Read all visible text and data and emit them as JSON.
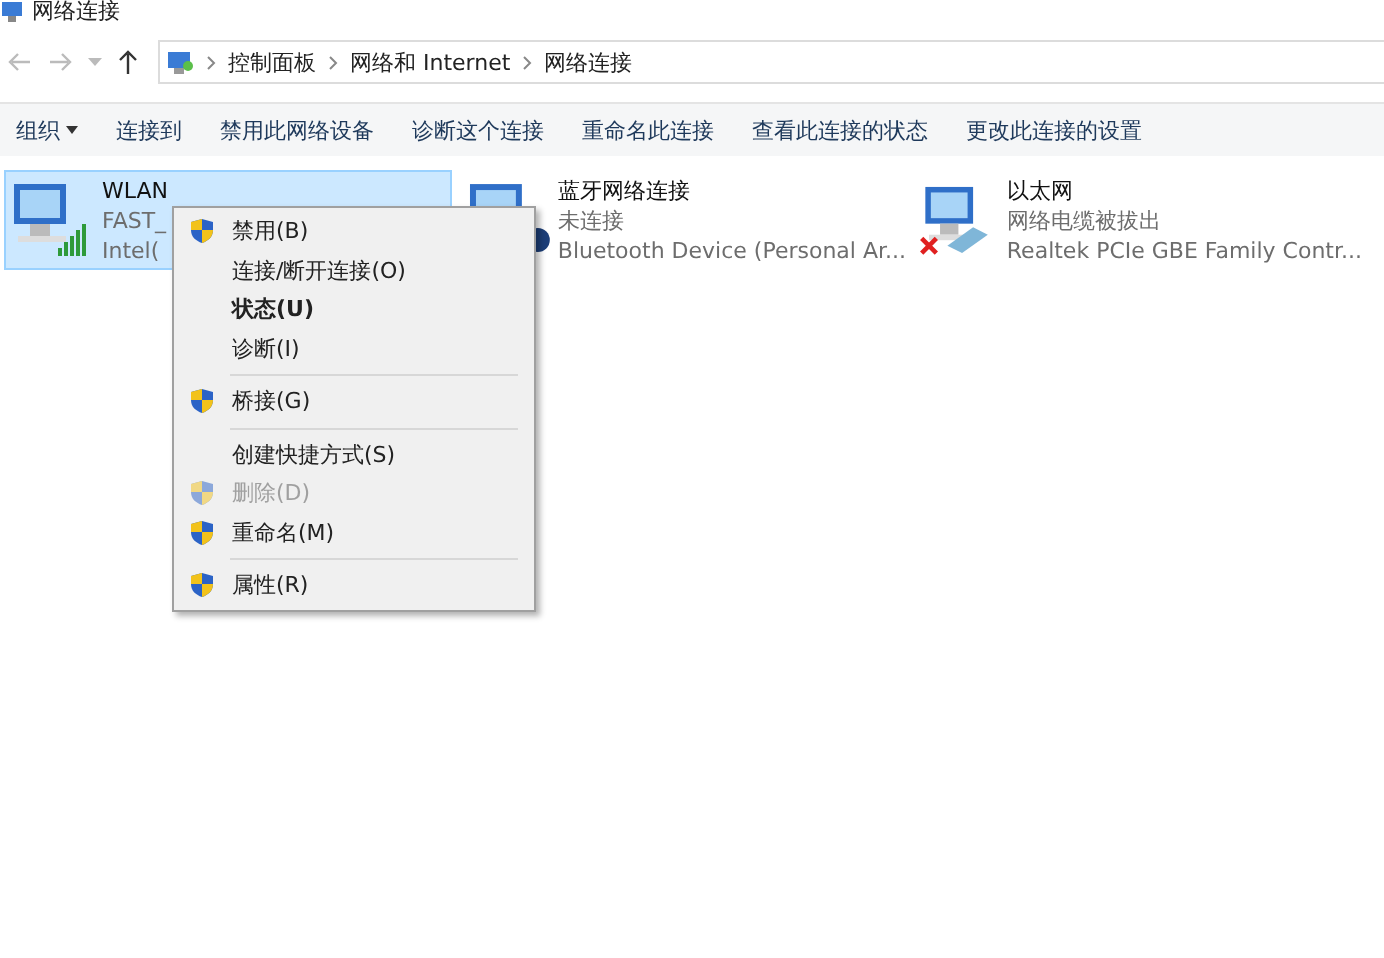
{
  "window": {
    "title": "网络连接"
  },
  "address_bar": {
    "crumbs": [
      "控制面板",
      "网络和 Internet",
      "网络连接"
    ]
  },
  "toolbar": [
    {
      "label": "组织",
      "dropdown": true
    },
    {
      "label": "连接到",
      "dropdown": false
    },
    {
      "label": "禁用此网络设备",
      "dropdown": false
    },
    {
      "label": "诊断这个连接",
      "dropdown": false
    },
    {
      "label": "重命名此连接",
      "dropdown": false
    },
    {
      "label": "查看此连接的状态",
      "dropdown": false
    },
    {
      "label": "更改此连接的设置",
      "dropdown": false
    }
  ],
  "connections": [
    {
      "name": "WLAN",
      "status": "FAST_",
      "device": "Intel(",
      "kind": "wifi",
      "selected": true
    },
    {
      "name": "蓝牙网络连接",
      "status": "未连接",
      "device": "Bluetooth Device (Personal Ar...",
      "kind": "bluetooth",
      "selected": false
    },
    {
      "name": "以太网",
      "status": "网络电缆被拔出",
      "device": "Realtek PCIe GBE Family Contr...",
      "kind": "ethernet",
      "selected": false
    }
  ],
  "context_menu": [
    {
      "kind": "item",
      "label": "禁用(B)",
      "shield": true,
      "disabled": false,
      "default": false
    },
    {
      "kind": "item",
      "label": "连接/断开连接(O)",
      "shield": false,
      "disabled": false,
      "default": false
    },
    {
      "kind": "item",
      "label": "状态(U)",
      "shield": false,
      "disabled": false,
      "default": true
    },
    {
      "kind": "item",
      "label": "诊断(I)",
      "shield": false,
      "disabled": false,
      "default": false
    },
    {
      "kind": "separator"
    },
    {
      "kind": "item",
      "label": "桥接(G)",
      "shield": true,
      "disabled": false,
      "default": false
    },
    {
      "kind": "separator"
    },
    {
      "kind": "item",
      "label": "创建快捷方式(S)",
      "shield": false,
      "disabled": false,
      "default": false
    },
    {
      "kind": "item",
      "label": "删除(D)",
      "shield": true,
      "disabled": true,
      "default": false
    },
    {
      "kind": "item",
      "label": "重命名(M)",
      "shield": true,
      "disabled": false,
      "default": false
    },
    {
      "kind": "separator"
    },
    {
      "kind": "item",
      "label": "属性(R)",
      "shield": true,
      "disabled": false,
      "default": false
    }
  ]
}
